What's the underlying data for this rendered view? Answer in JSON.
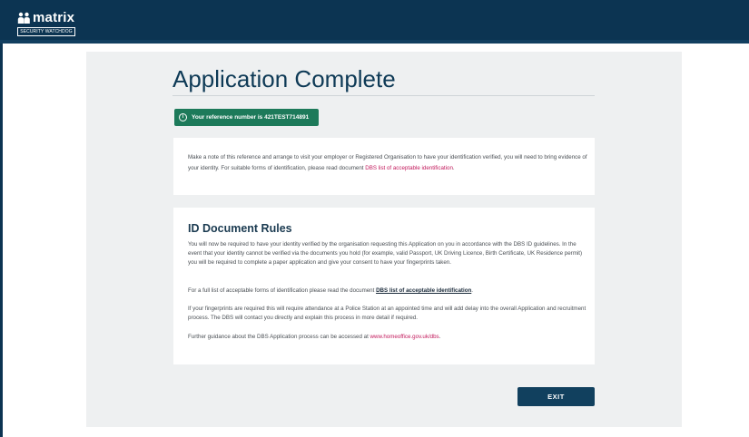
{
  "header": {
    "logo_word": "matrix",
    "logo_sub": "SECURITY WATCHDOG",
    "colors": {
      "bar": "#0c3452"
    }
  },
  "main": {
    "title": "Application Complete",
    "reference": {
      "icon": "info-circle-icon",
      "text": "Your reference number is 421TEST714891",
      "color": "#1d7a5a"
    },
    "note": {
      "text": "Make a note of this reference and arrange to visit your employer or Registered Organisation to have your identification verified, you will need to bring evidence of your identity. For suitable forms of identification, please read document ",
      "link": "DBS list of acceptable identification",
      "suffix": "."
    },
    "id_rules": {
      "heading": "ID Document Rules",
      "p1": "You will now be required to have your identity verified by the organisation requesting this Application on you in accordance with the DBS ID guidelines. In the event that your identity cannot be verified via the documents you hold (for example, valid Passport, UK Driving Licence, Birth Certificate, UK Residence permit) you will be required to complete a paper application and give your consent to have your fingerprints taken.",
      "p2_text": "For a full list of acceptable forms of identification please read the document ",
      "p2_link": "DBS list of acceptable identification",
      "p2_suffix": ".",
      "p3": "If your fingerprints are required this will require attendance at a Police Station at an appointed time and will add delay into the overall Application and recruitment process. The DBS will contact you directly and explain this process in more detail if required.",
      "p4_text": "Further guidance about the DBS Application process can be accessed at ",
      "p4_link": "www.homeoffice.gov.uk/dbs",
      "p4_suffix": "."
    },
    "exit_label": "EXIT"
  }
}
